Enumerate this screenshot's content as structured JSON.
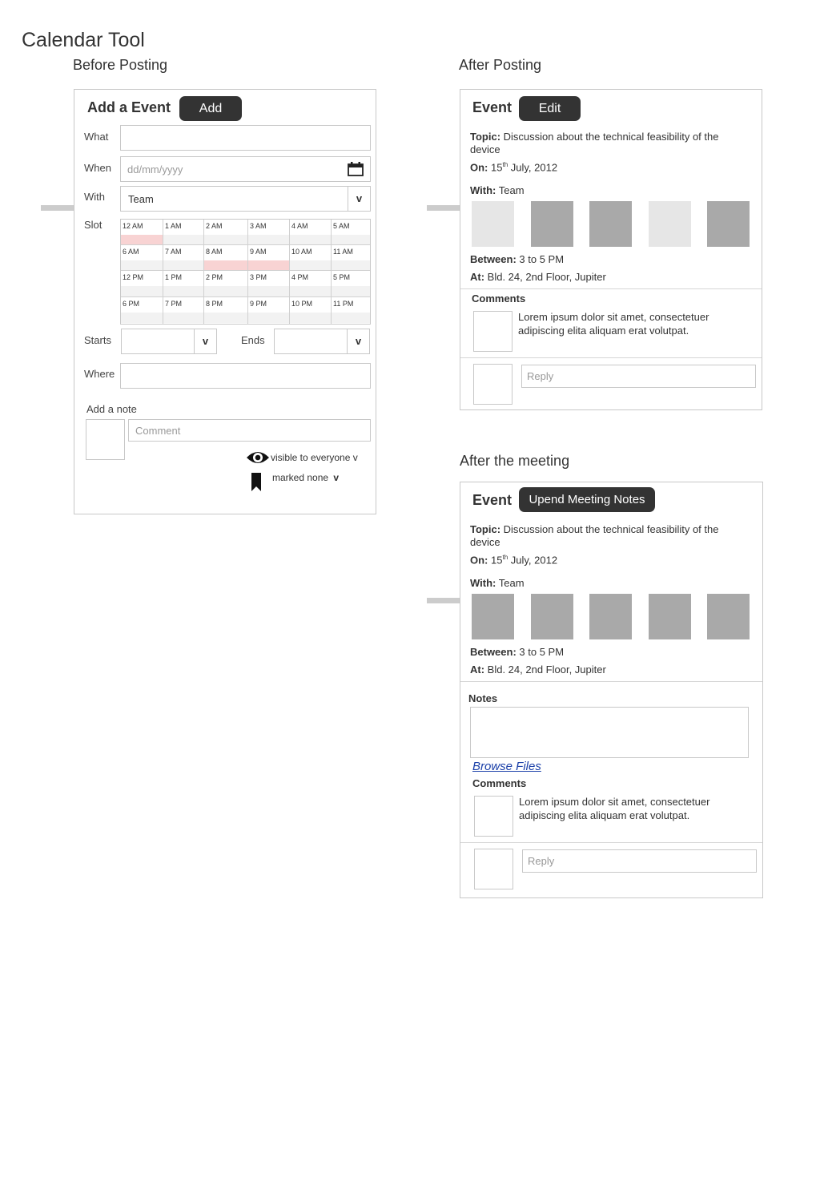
{
  "page": {
    "title": "Calendar Tool"
  },
  "sections": {
    "before": "Before Posting",
    "after": "After Posting",
    "after_meeting": "After the meeting"
  },
  "add_event": {
    "heading": "Add a Event",
    "add_button": "Add",
    "what_label": "What",
    "what_value": "",
    "when_label": "When",
    "when_placeholder": "dd/mm/yyyy",
    "with_label": "With",
    "with_value": "Team",
    "chevron": "v",
    "slot_label": "Slot",
    "slot_rows": [
      {
        "times": [
          "12 AM",
          "1 AM",
          "2 AM",
          "3 AM",
          "4 AM",
          "5 AM"
        ],
        "selected": [
          true,
          false,
          false,
          false,
          false,
          false
        ]
      },
      {
        "times": [
          "6 AM",
          "7 AM",
          "8 AM",
          "9 AM",
          "10 AM",
          "11 AM"
        ],
        "selected": [
          false,
          false,
          true,
          true,
          false,
          false
        ]
      },
      {
        "times": [
          "12 PM",
          "1 PM",
          "2 PM",
          "3 PM",
          "4 PM",
          "5 PM"
        ],
        "selected": [
          false,
          false,
          false,
          false,
          false,
          false
        ]
      },
      {
        "times": [
          "6 PM",
          "7 PM",
          "8 PM",
          "9 PM",
          "10 PM",
          "11 PM"
        ],
        "selected": [
          false,
          false,
          false,
          false,
          false,
          false
        ]
      }
    ],
    "starts_label": "Starts",
    "ends_label": "Ends",
    "where_label": "Where",
    "note_label": "Add a note",
    "comment_placeholder": "Comment",
    "visibility": "visible to everyone v",
    "marked": "marked none",
    "marked_chevron": "v",
    "icons": {
      "calendar": "calendar-icon",
      "eye": "eye-icon",
      "bookmark": "bookmark-icon"
    }
  },
  "event_posted": {
    "heading": "Event",
    "edit_button": "Edit",
    "topic_label": "Topic:",
    "topic_value": "Discussion about the technical feasibility of the device",
    "on_label": "On:",
    "on_day": "15",
    "on_sup": "th",
    "on_rest": "July, 2012",
    "with_label": "With:",
    "with_value": "Team",
    "attendee_colors": [
      "#e6e6e6",
      "#a9a9a9",
      "#a9a9a9",
      "#e6e6e6",
      "#a9a9a9"
    ],
    "between_label": "Between:",
    "between_value": "3 to 5 PM",
    "at_label": "At:",
    "at_value": "Bld. 24, 2nd Floor, Jupiter",
    "comments_label": "Comments",
    "comment_text": "Lorem ipsum dolor sit amet, consectetuer adipiscing elita aliquam erat volutpat.",
    "reply_placeholder": "Reply"
  },
  "event_meeting": {
    "heading": "Event",
    "upend_button": "Upend Meeting Notes",
    "topic_label": "Topic:",
    "topic_value": "Discussion about the technical feasibility of the device",
    "on_label": "On:",
    "on_day": "15",
    "on_sup": "th",
    "on_rest": "July, 2012",
    "with_label": "With:",
    "with_value": "Team",
    "attendee_colors": [
      "#a9a9a9",
      "#a9a9a9",
      "#a9a9a9",
      "#a9a9a9",
      "#a9a9a9"
    ],
    "between_label": "Between:",
    "between_value": "3 to 5 PM",
    "at_label": "At:",
    "at_value": "Bld. 24, 2nd Floor, Jupiter",
    "notes_label": "Notes",
    "browse_label": "Browse Files",
    "comments_label": "Comments",
    "comment_text": "Lorem ipsum dolor sit amet, consectetuer adipiscing elita aliquam erat volutpat.",
    "reply_placeholder": "Reply"
  }
}
